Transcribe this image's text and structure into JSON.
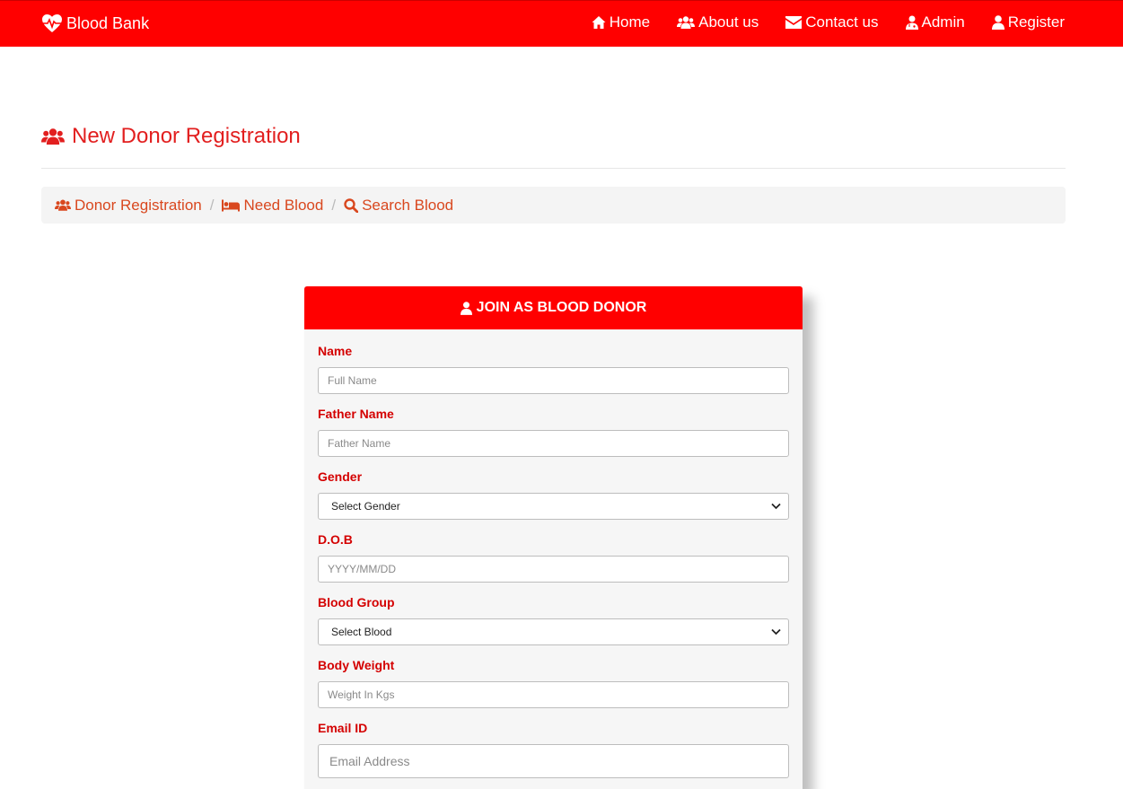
{
  "navbar": {
    "brand": "Blood Bank",
    "items": [
      {
        "label": "Home",
        "icon": "home-icon"
      },
      {
        "label": "About us",
        "icon": "users-icon"
      },
      {
        "label": "Contact us",
        "icon": "envelope-icon"
      },
      {
        "label": "Admin",
        "icon": "user-md-icon"
      },
      {
        "label": "Register",
        "icon": "user-icon"
      }
    ]
  },
  "page": {
    "title": "New Donor Registration"
  },
  "breadcrumb": [
    {
      "label": "Donor Registration",
      "icon": "users-icon"
    },
    {
      "label": "Need Blood",
      "icon": "bed-icon"
    },
    {
      "label": "Search Blood",
      "icon": "search-icon"
    }
  ],
  "breadcrumb_separator": "/",
  "form": {
    "title": "JOIN AS BLOOD DONOR",
    "fields": {
      "name": {
        "label": "Name",
        "placeholder": "Full Name"
      },
      "father_name": {
        "label": "Father Name",
        "placeholder": "Father Name"
      },
      "gender": {
        "label": "Gender",
        "selected": "Select Gender"
      },
      "dob": {
        "label": "D.O.B",
        "placeholder": "YYYY/MM/DD"
      },
      "blood_group": {
        "label": "Blood Group",
        "selected": "Select Blood"
      },
      "body_weight": {
        "label": "Body Weight",
        "placeholder": "Weight In Kgs"
      },
      "email": {
        "label": "Email ID",
        "placeholder": "Email Address"
      }
    }
  },
  "colors": {
    "primary": "#ff0000",
    "label": "#d40000",
    "link": "#d9481f"
  }
}
